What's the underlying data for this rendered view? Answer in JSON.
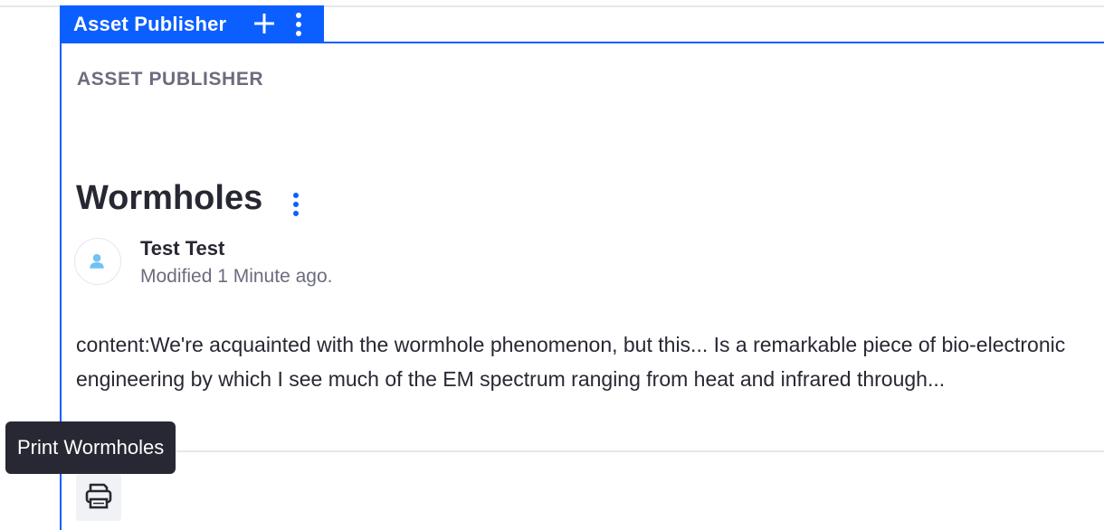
{
  "topper": {
    "title": "Asset Publisher",
    "add_icon": "plus-icon",
    "options_icon": "vertical-ellipsis-icon",
    "accent_color": "#0b5fff"
  },
  "portlet": {
    "heading": "ASSET PUBLISHER"
  },
  "asset": {
    "title": "Wormholes",
    "options_icon": "vertical-ellipsis-icon",
    "author": "Test Test",
    "avatar_icon": "user-icon",
    "modified": "Modified 1 Minute ago.",
    "summary": "content:We're acquainted with the wormhole phenomenon, but this... Is a remarkable piece of bio-electronic engineering by which I see much of the EM spectrum ranging from heat and infrared through..."
  },
  "actions": {
    "print_icon": "print-icon",
    "print_tooltip": "Print Wormholes"
  }
}
